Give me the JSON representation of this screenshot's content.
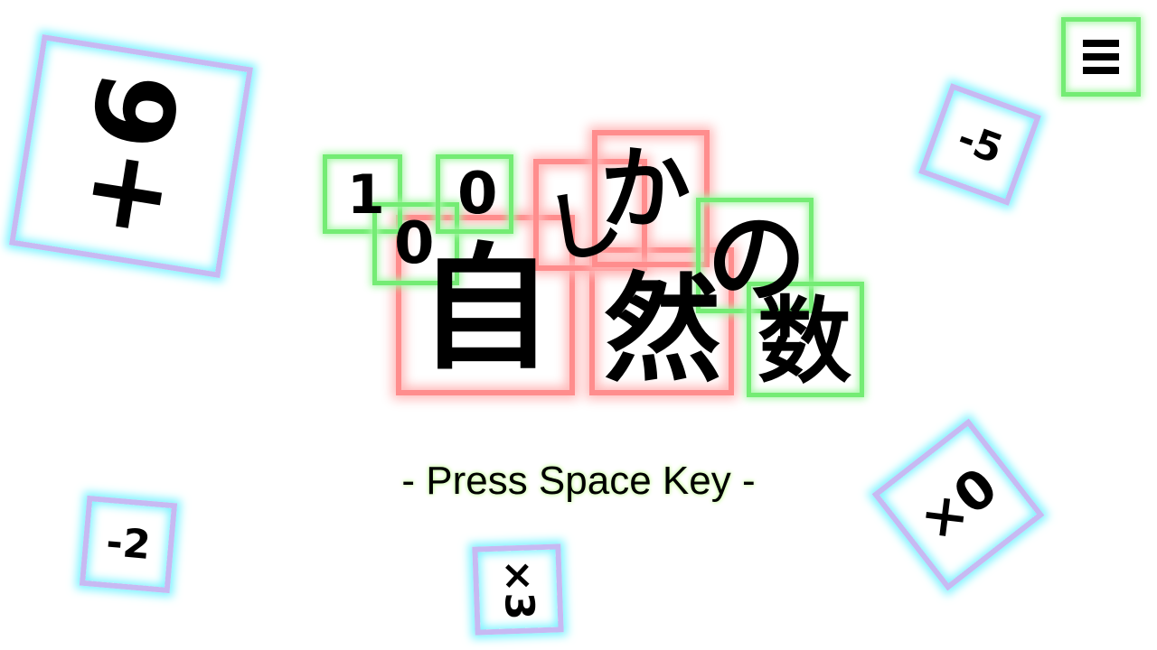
{
  "title": {
    "row1": [
      "1",
      "0",
      "0",
      "し",
      "か"
    ],
    "row2": [
      "自",
      "然",
      "の",
      "数"
    ]
  },
  "prompt": "- Press Space Key -",
  "tiles": [
    {
      "label": "+6"
    },
    {
      "label": "-5"
    },
    {
      "label": "-2"
    },
    {
      "label": "×3"
    },
    {
      "label": "×0"
    }
  ],
  "menu": {
    "icon": "hamburger-menu-icon"
  },
  "colors": {
    "green": "#74ec74",
    "red": "#ff8d8d",
    "cyan_glow": "#7ff3ff",
    "lavender": "#c7b9f2"
  }
}
